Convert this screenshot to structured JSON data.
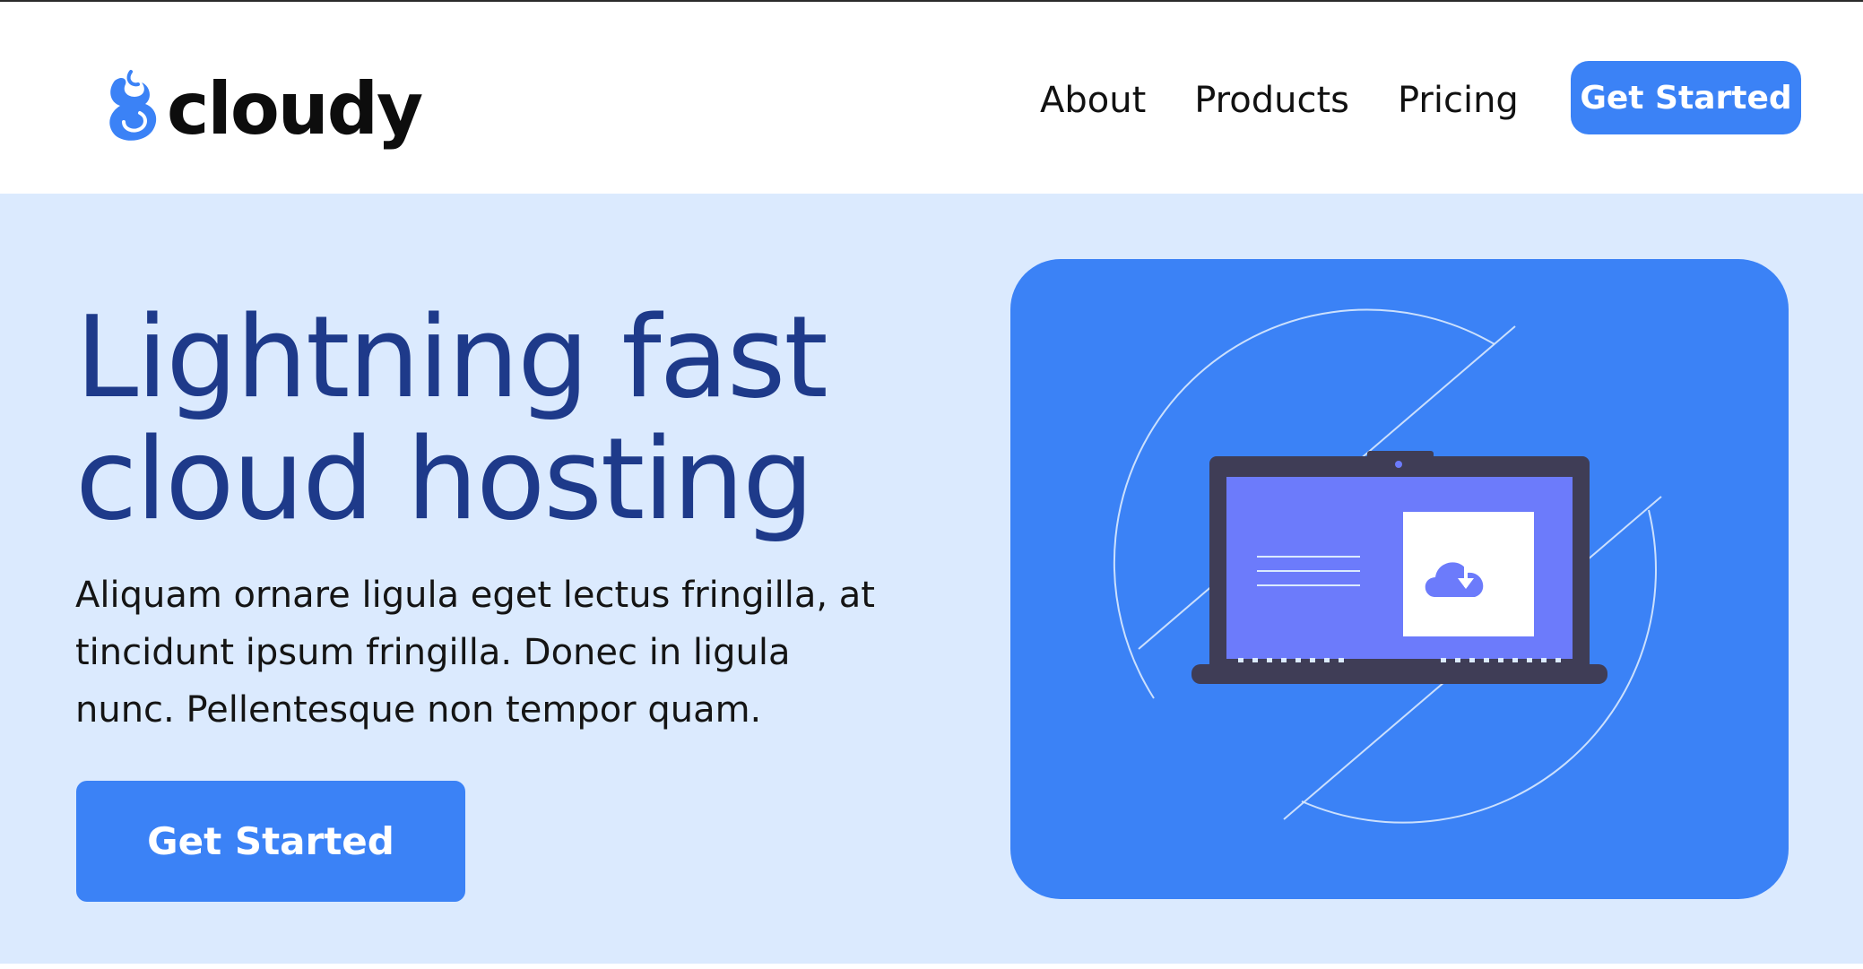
{
  "header": {
    "brand_name": "cloudy",
    "nav": [
      {
        "label": "About"
      },
      {
        "label": "Products"
      },
      {
        "label": "Pricing"
      }
    ],
    "cta_label": "Get Started"
  },
  "hero": {
    "title_line_1": "Lightning fast",
    "title_line_2": "cloud hosting",
    "description": "Aliquam ornare ligula eget lectus fringilla, at tincidunt ipsum fringilla. Donec in ligula nunc. Pellentesque non tempor quam.",
    "cta_label": "Get Started",
    "illustration": {
      "subject": "laptop with cloud download",
      "icon": "cloud-download-icon"
    }
  },
  "colors": {
    "accent": "#3b82f6",
    "hero_background": "#dbeafe",
    "title": "#1e3a8a",
    "laptop_frame": "#3f3d56",
    "laptop_screen": "#6c7bfb"
  }
}
